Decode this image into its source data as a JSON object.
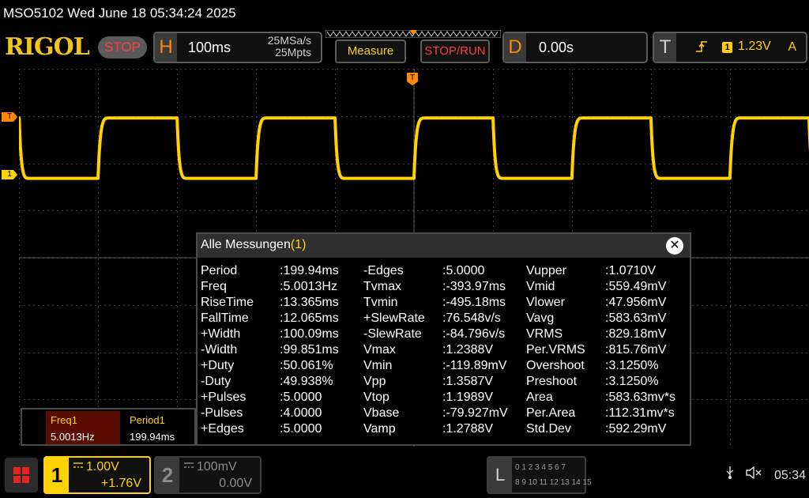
{
  "title_bar": {
    "text": "MSO5102  Wed June 18 05:34:24 2025"
  },
  "brand": {
    "logo": "RIGOL",
    "run_state": "STOP"
  },
  "horizontal": {
    "letter": "H",
    "timebase": "100ms",
    "sample_rate": "25MSa/s",
    "memory_depth": "25Mpts"
  },
  "buttons": {
    "measure": "Measure",
    "stop_run": "STOP/RUN"
  },
  "delay": {
    "letter": "D",
    "value": "0.00s"
  },
  "trigger": {
    "letter": "T",
    "edge_icon": "rising-edge-icon",
    "source": "1",
    "level": "1.23V",
    "mode": "A"
  },
  "markers": {
    "trigger_level": "T",
    "channel1": "1",
    "trigger_position": "T"
  },
  "measurements": {
    "title": "Alle Messungen",
    "count": "(1)",
    "close_icon": "close-icon",
    "columns": [
      [
        {
          "k": "Period",
          "v": ":199.94ms"
        },
        {
          "k": "Freq",
          "v": ":5.0013Hz"
        },
        {
          "k": "RiseTime",
          "v": ":13.365ms"
        },
        {
          "k": "FallTime",
          "v": ":12.065ms"
        },
        {
          "k": "+Width",
          "v": ":100.09ms"
        },
        {
          "k": "-Width",
          "v": ":99.851ms"
        },
        {
          "k": "+Duty",
          "v": ":50.061%"
        },
        {
          "k": "-Duty",
          "v": ":49.938%"
        },
        {
          "k": "+Pulses",
          "v": ":5.0000"
        },
        {
          "k": "-Pulses",
          "v": ":4.0000"
        },
        {
          "k": "+Edges",
          "v": ":5.0000"
        }
      ],
      [
        {
          "k": "-Edges",
          "v": ":5.0000"
        },
        {
          "k": "Tvmax",
          "v": ":-393.97ms"
        },
        {
          "k": "Tvmin",
          "v": ":-495.18ms"
        },
        {
          "k": "+SlewRate",
          "v": ":76.548v/s"
        },
        {
          "k": "-SlewRate",
          "v": ":-84.796v/s"
        },
        {
          "k": "Vmax",
          "v": ":1.2388V"
        },
        {
          "k": "Vmin",
          "v": ":-119.89mV"
        },
        {
          "k": "Vpp",
          "v": ":1.3587V"
        },
        {
          "k": "Vtop",
          "v": ":1.1989V"
        },
        {
          "k": "Vbase",
          "v": ":-79.927mV"
        },
        {
          "k": "Vamp",
          "v": ":1.2788V"
        }
      ],
      [
        {
          "k": "Vupper",
          "v": ":1.0710V"
        },
        {
          "k": "Vmid",
          "v": ":559.49mV"
        },
        {
          "k": "Vlower",
          "v": ":47.956mV"
        },
        {
          "k": "Vavg",
          "v": ":583.63mV"
        },
        {
          "k": "VRMS",
          "v": ":829.18mV"
        },
        {
          "k": "Per.VRMS",
          "v": ":815.76mV"
        },
        {
          "k": "Overshoot",
          "v": ":3.1250%"
        },
        {
          "k": "Preshoot",
          "v": ":3.1250%"
        },
        {
          "k": "Area",
          "v": ":583.63mv*s"
        },
        {
          "k": "Per.Area",
          "v": ":112.31mv*s"
        },
        {
          "k": "Std.Dev",
          "v": ":592.29mV"
        }
      ]
    ]
  },
  "quick_measure": {
    "items": [
      {
        "label": "Freq1",
        "value": "5.0013Hz"
      },
      {
        "label": "Period1",
        "value": "199.94ms"
      }
    ]
  },
  "channels": [
    {
      "number": "1",
      "scale": "1.00V",
      "offset": "+1.76V",
      "active": true
    },
    {
      "number": "2",
      "scale": "100mV",
      "offset": "0.00V",
      "active": false
    }
  ],
  "logic": {
    "letter": "L",
    "row1": "0 1 2 3   4 5 6 7",
    "row2": "8 9 10 11  12 13 14 15"
  },
  "status": {
    "usb_icon": "usb-icon",
    "sound_icon": "speaker-muted-icon",
    "time": "05:34"
  },
  "waveform": {
    "channel": "1",
    "type": "square",
    "frequency_hz": 5.0013,
    "period_ms": 199.94,
    "duty_percent": 50.06,
    "vmax_v": 1.2388,
    "vmin_v": -0.11989,
    "timebase_s_per_div": 0.1,
    "volts_per_div": 1.0,
    "offset_v": 1.76
  },
  "colors": {
    "channel1": "#ffd200",
    "trigger": "#ff8a00",
    "stop": "#ff3c3c",
    "grid": "#3c3c3c"
  }
}
